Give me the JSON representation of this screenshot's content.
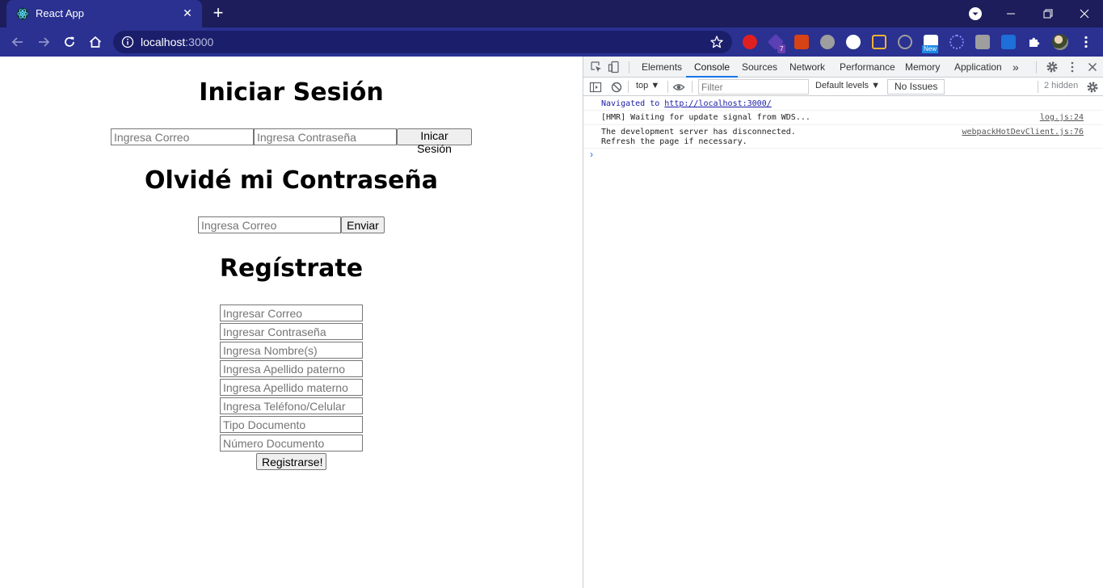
{
  "browser": {
    "tab_title": "React App",
    "tab_close": "✕",
    "new_tab": "+",
    "url_host": "localhost",
    "url_port": ":3000",
    "extension_badge_count": "7",
    "extension_new_badge": "New",
    "window_controls": [
      "minimize-icon",
      "restore-icon",
      "close-icon"
    ]
  },
  "login": {
    "title": "Iniciar Sesión",
    "email_placeholder": "Ingresa Correo",
    "password_placeholder": "Ingresa Contraseña",
    "submit_label": "Inicar Sesión"
  },
  "forgot": {
    "title": "Olvidé mi Contraseña",
    "email_placeholder": "Ingresa Correo",
    "submit_label": "Enviar"
  },
  "register": {
    "title": "Regístrate",
    "fields": [
      "Ingresar Correo",
      "Ingresar Contraseña",
      "Ingresa Nombre(s)",
      "Ingresa Apellido paterno",
      "Ingresa Apellido materno",
      "Ingresa Teléfono/Celular",
      "Tipo Documento",
      "Número Documento"
    ],
    "submit_label": "Registrarse!"
  },
  "devtools": {
    "tabs": [
      "Elements",
      "Console",
      "Sources",
      "Network",
      "Performance",
      "Memory",
      "Application"
    ],
    "active_tab": "Console",
    "more_tabs": "»",
    "context": "top ▼",
    "filter_placeholder": "Filter",
    "levels": "Default levels ▼",
    "issues": "No Issues",
    "hidden": "2 hidden",
    "messages": [
      {
        "text": "Navigated to ",
        "link": "http://localhost:3000/",
        "source": ""
      },
      {
        "text": "[HMR] Waiting for update signal from WDS...",
        "source": "log.js:24"
      },
      {
        "text": "The development server has disconnected.\nRefresh the page if necessary.",
        "source": "webpackHotDevClient.js:76"
      }
    ],
    "prompt": "›"
  },
  "colors": {
    "tabbar": "#1c1d5a",
    "toolbar": "#2a3191",
    "accent": "#1a73e8"
  }
}
